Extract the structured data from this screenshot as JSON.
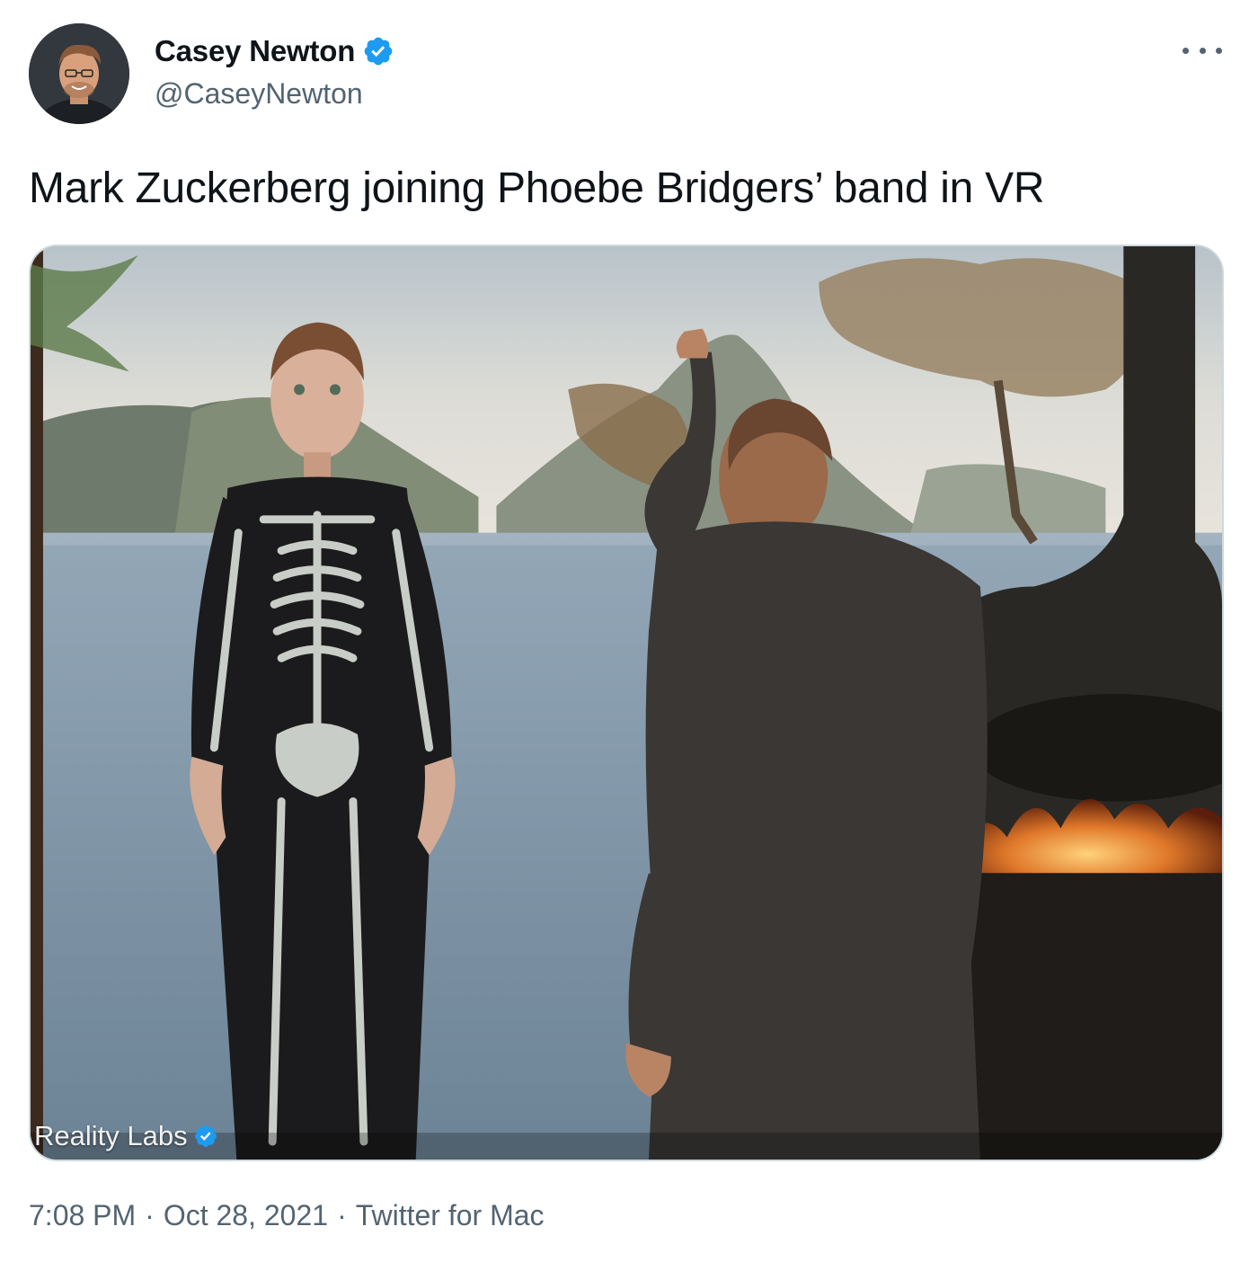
{
  "author": {
    "display_name": "Casey Newton",
    "handle": "@CaseyNewton",
    "verified": true,
    "avatar_icon": "profile-photo"
  },
  "tweet": {
    "text": "Mark Zuckerberg joining Phoebe Bridgers’ band in VR"
  },
  "media": {
    "attribution": "Reality Labs",
    "attribution_verified": true
  },
  "meta": {
    "time": "7:08 PM",
    "separator": "·",
    "date": "Oct 28, 2021",
    "source": "Twitter for Mac"
  },
  "colors": {
    "verified_blue": "#1d9bf0",
    "secondary_text": "#536471",
    "primary_text": "#0f1419"
  }
}
